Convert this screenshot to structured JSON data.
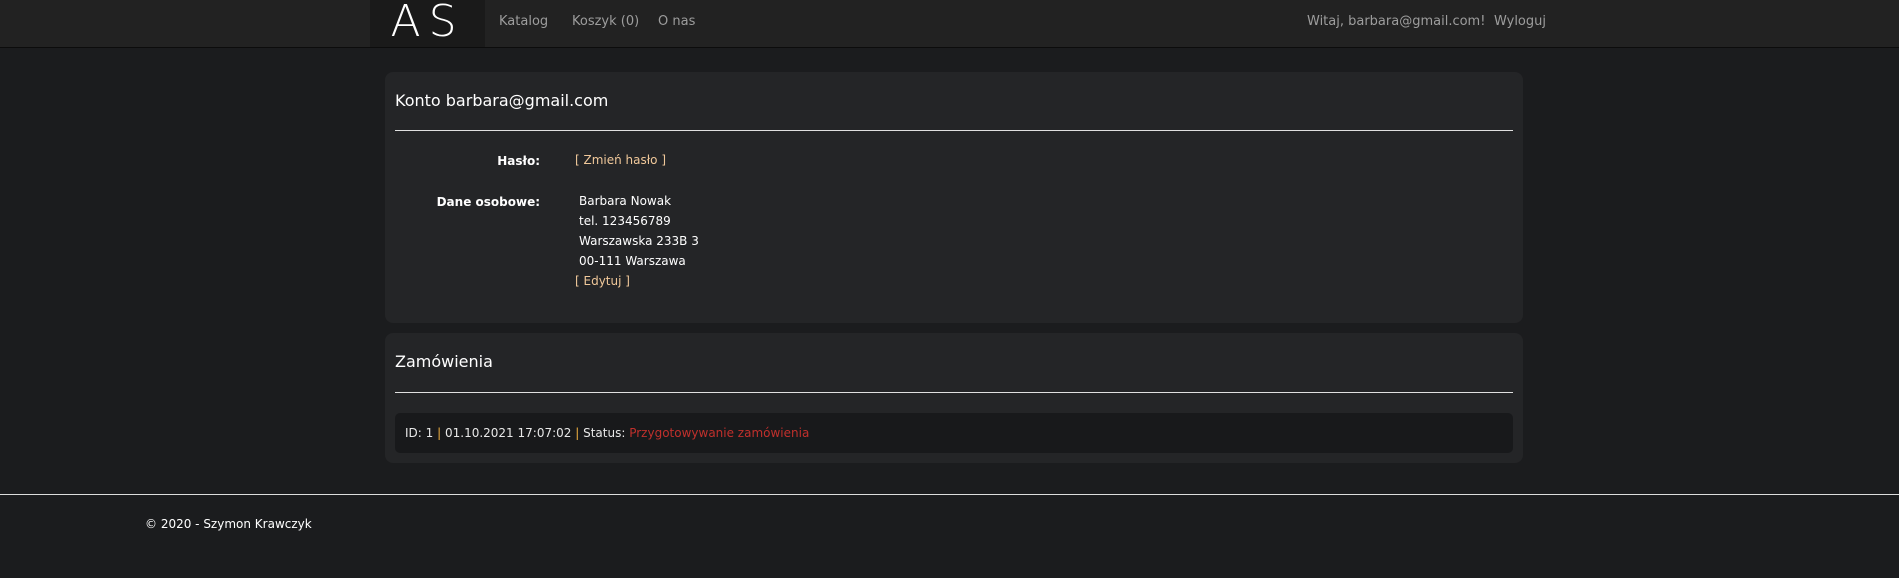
{
  "navbar": {
    "logo": "AS",
    "links": [
      "Katalog",
      "Koszyk (0)",
      "O nas"
    ],
    "greeting": "Witaj, barbara@gmail.com!",
    "logout": "Wyloguj"
  },
  "account": {
    "title": "Konto barbara@gmail.com",
    "password_label": "Hasło:",
    "change_password": "[ Zmień hasło ]",
    "personal_label": "Dane osobowe:",
    "name": "Barbara Nowak",
    "phone": "tel. 123456789",
    "street": "Warszawska 233B 3",
    "city": "00-111 Warszawa",
    "edit": "[ Edytuj ]"
  },
  "orders": {
    "title": "Zamówienia",
    "items": [
      {
        "id": "ID: 1",
        "date": "01.10.2021 17:07:02",
        "status_label": "Status:",
        "status": "Przygotowywanie zamówienia"
      }
    ],
    "separator": "|"
  },
  "footer": {
    "text": "© 2020 - Szymon Krawczyk"
  },
  "colors": {
    "accent_link": "#f0c89a",
    "status": "#c0302c"
  }
}
